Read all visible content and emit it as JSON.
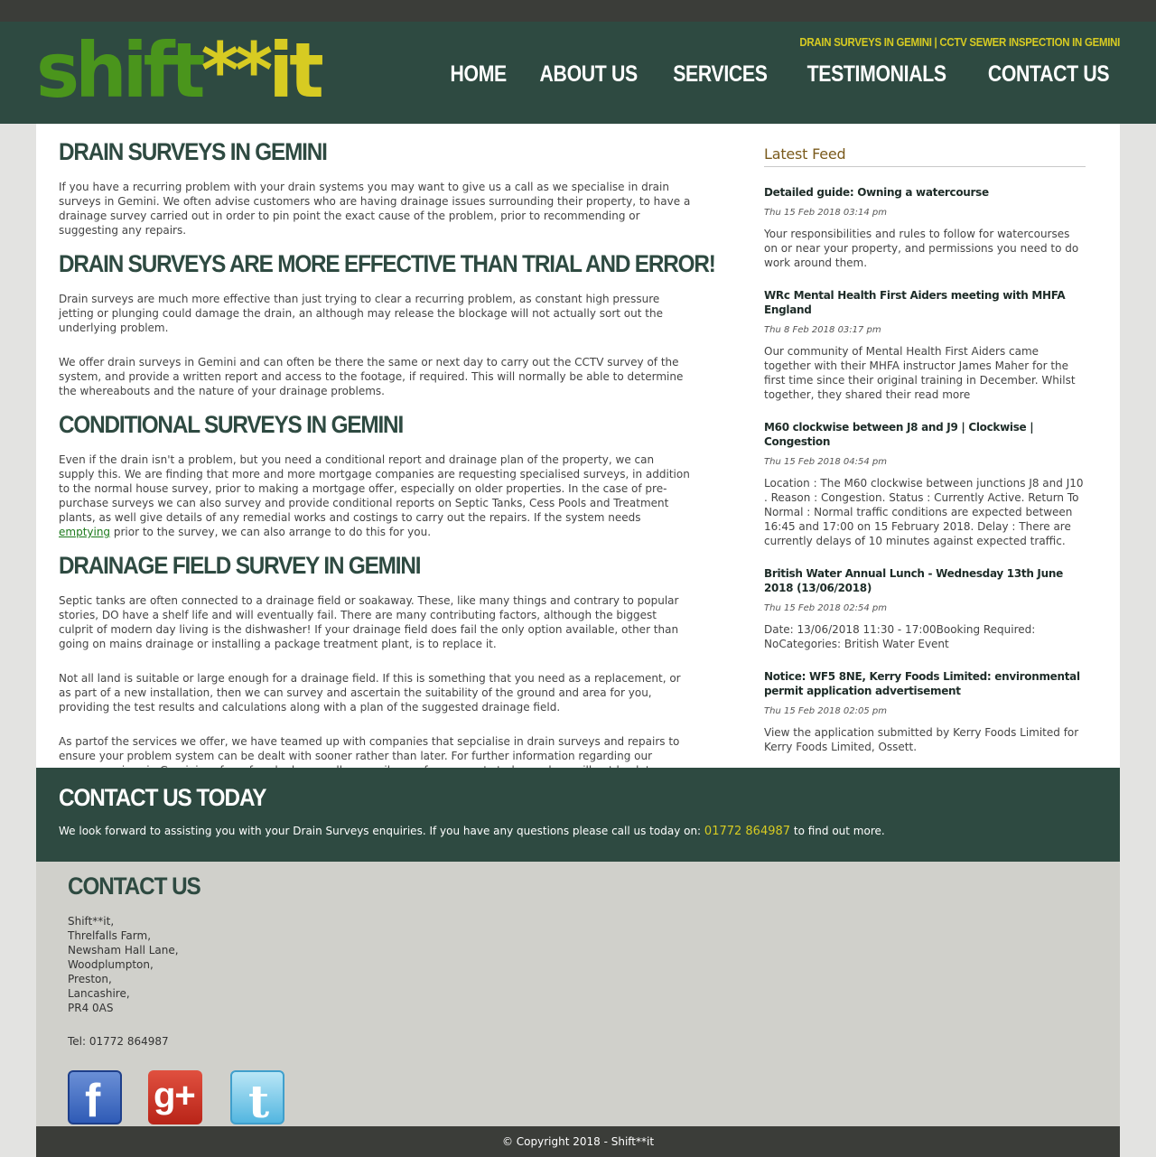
{
  "brand": {
    "logo_green": "shift",
    "logo_yellow": "**it",
    "green": "#4a951c",
    "yellow": "#d7cb22",
    "dark": "#2e4a41"
  },
  "header": {
    "tagline": "DRAIN SURVEYS IN GEMINI | CCTV SEWER INSPECTION IN GEMINI",
    "nav": [
      "HOME",
      "ABOUT US",
      "SERVICES",
      "TESTIMONIALS",
      "CONTACT US"
    ]
  },
  "content": {
    "h1": "DRAIN SURVEYS IN GEMINI",
    "p1": "If you have a recurring problem with your drain systems you may want to give us a call as we specialise in drain surveys in Gemini. We often advise customers who are having drainage issues surrounding their property, to have a drainage survey carried out in order to pin point the exact cause of the problem, prior to recommending or suggesting any repairs.",
    "h2": "DRAIN SURVEYS ARE MORE EFFECTIVE THAN TRIAL AND ERROR!",
    "p2": "Drain surveys are much more effective than just trying to clear a recurring problem, as constant high pressure jetting or plunging could damage the drain, an although may release the blockage will not actually sort out the underlying problem.",
    "p3": "We offer drain surveys in Gemini and can often be there the same or next day to carry out the CCTV survey of the system, and provide a written report and access to the footage, if required. This will normally be able to determine the whereabouts and the nature of your drainage problems.",
    "h3": "CONDITIONAL SURVEYS IN GEMINI",
    "p4_before": "Even if the drain isn't a problem, but you need a conditional report and drainage plan of the property, we can supply this. We are finding that more and more mortgage companies are requesting specialised surveys, in addition to the normal house survey, prior to making a mortgage offer, especially on older properties. In the case of pre-purchase surveys we can also survey and provide conditional reports on Septic Tanks, Cess Pools and Treatment plants, as well give details of any remedial works and costings to carry out the repairs. If the system needs ",
    "p4_link": "emptying",
    "p4_after": " prior to the survey, we can also arrange to do this for you.",
    "h4": "DRAINAGE FIELD SURVEY IN GEMINI",
    "p5": "Septic tanks are often connected to a drainage field or soakaway. These, like many things and contrary to popular stories, DO have a shelf life and will eventually fail. There are many contributing factors, although the biggest culprit of modern day living is the dishwasher! If your drainage field does fail the only option available, other than going on mains drainage or installing a package treatment plant, is to replace it.",
    "p6": "Not all land is suitable or large enough for a drainage field. If this is something that you need as a replacement, or as part of a new installation, then we can survey and ascertain the suitability of the ground and area for you, providing the test results and calculations along with a plan of the suggested drainage field.",
    "p7": "As partof the services we offer, we have teamed up with companies that sepcialise in drain surveys and repairs to ensure your problem system can be dealt with sooner rather than later.  For further information regarding our survey services in Gemini, or for referral,  please call or email one of our experts today and we will get back to you as soon as we can."
  },
  "feed": {
    "title": "Latest Feed",
    "items": [
      {
        "title": "Detailed guide: Owning a watercourse",
        "date": "Thu 15 Feb 2018 03:14 pm",
        "desc": "Your responsibilities and rules to follow for watercourses on or near your property, and permissions you need to do work around them."
      },
      {
        "title": "WRc Mental Health First Aiders meeting with MHFA England",
        "date": "Thu 8 Feb 2018 03:17 pm",
        "desc": "Our community of Mental Health First Aiders came together with their MHFA instructor James Maher for the first time since their original training in December. Whilst together, they shared their read more"
      },
      {
        "title": "M60 clockwise between J8 and J9 | Clockwise | Congestion",
        "date": "Thu 15 Feb 2018 04:54 pm",
        "desc": "Location : The M60 clockwise between junctions J8 and J10 . Reason : Congestion. Status : Currently Active. Return To Normal : Normal traffic conditions are expected between 16:45 and 17:00 on 15 February 2018. Delay : There are currently delays of 10 minutes against expected traffic."
      },
      {
        "title": "British Water Annual Lunch - Wednesday 13th June 2018 (13/06/2018)",
        "date": "Thu 15 Feb 2018 02:54 pm",
        "desc": "Date: 13/06/2018 11:30 - 17:00Booking Required: NoCategories: British Water Event"
      },
      {
        "title": "Notice: WF5 8NE, Kerry Foods Limited: environmental permit application advertisement",
        "date": "Thu 15 Feb 2018 02:05 pm",
        "desc": "View the application submitted by Kerry Foods Limited for Kerry Foods Limited, Ossett."
      }
    ]
  },
  "cta": {
    "title": "CONTACT US TODAY",
    "text_before": "We look forward to assisting you with your Drain Surveys enquiries. If you have any questions please call us today on: ",
    "phone": "01772 864987",
    "text_after": " to find out more."
  },
  "contact": {
    "title": "CONTACT US",
    "address": [
      "Shift**it,",
      "Threlfalls Farm,",
      "Newsham Hall Lane,",
      "Woodplumpton,",
      "Preston,",
      "Lancashire,",
      "PR4 0AS"
    ],
    "tel": "Tel: 01772 864987",
    "social": [
      "facebook-icon",
      "google-plus-icon",
      "twitter-icon"
    ]
  },
  "footer": {
    "copyright": "© Copyright 2018 - Shift**it"
  }
}
